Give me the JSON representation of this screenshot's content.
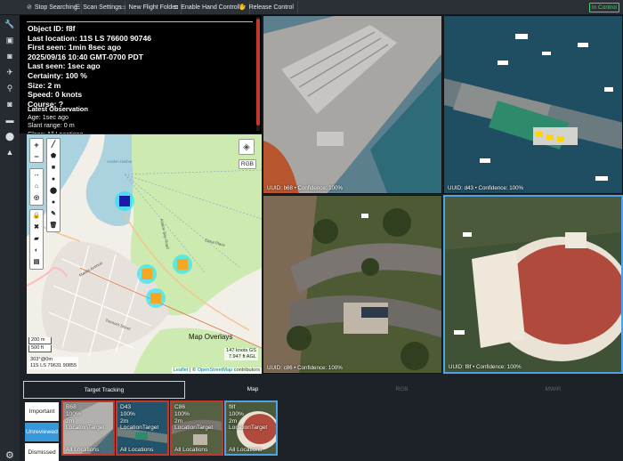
{
  "toolbar": {
    "buttons": [
      {
        "label": "Stop Searching",
        "icon": "no-entry-icon"
      },
      {
        "label": "Scan Settings",
        "icon": "sliders-icon"
      },
      {
        "label": "New Flight Folder",
        "icon": "folder-icon"
      },
      {
        "label": "Enable Hand Controller",
        "icon": "gamepad-icon"
      },
      {
        "label": "Release Control",
        "icon": "hand-icon"
      }
    ],
    "status": "In Control",
    "status_color": "#45d16b"
  },
  "rail": {
    "icons": [
      "wrench-icon",
      "image-icon",
      "camera-icon",
      "plane-icon",
      "person-icon",
      "camera-alt-icon",
      "truck-icon",
      "map-pin-icon",
      "graduation-cap-icon"
    ],
    "settings_icon": "gear-icon"
  },
  "info": {
    "object_id": "Object ID: f8f",
    "last_location": "Last location: 11S LS 76600 90746",
    "first_seen": "First seen: 1min 8sec ago",
    "first_seen_time": "2025/09/16 10:40 GMT-0700 PDT",
    "last_seen": "Last seen: 1sec ago",
    "certainty": "Certainty: 100 %",
    "size": "Size: 2 m",
    "speed": "Speed: 0 knots",
    "course": "Course: ?",
    "latest_title": "Latest Observation",
    "latest_age": "Age: 1sec ago",
    "latest_range": "Slant range: 0 m",
    "latest_class": "Class: All Locations"
  },
  "map": {
    "rgb_label": "RGB",
    "overlays_label": "Map Overlays",
    "scale_m": "200 m",
    "scale_ft": "500 ft",
    "heading": "303°@0m",
    "coords": "11S LS 79631 90855",
    "gsd_line1": "147 knots GS",
    "gsd_line2": "7.947 ft AGL",
    "attrib_leaflet": "Leaflet",
    "attrib_osm": "OpenStreetMap",
    "attrib_rest": "contributors",
    "street_labels": [
      "Avalon Harbor",
      "Avalon Bay Road",
      "Marilla Avenue",
      "Dana Place",
      "Tremont Street"
    ]
  },
  "tiles": [
    {
      "caption": "UUID: b68 • Confidence: 100%"
    },
    {
      "caption": "UUID: d43 • Confidence: 100%"
    },
    {
      "caption": "UUID: c86 • Confidence: 100%"
    },
    {
      "caption": "UUID: f8f • Confidence: 100%"
    }
  ],
  "tabs": [
    "Target Tracking",
    "Map",
    "RGB",
    "MWIR"
  ],
  "filters": [
    "Important",
    "Unreviewed",
    "Dismissed"
  ],
  "thumbs": [
    {
      "id": "B68",
      "certainty": "100%",
      "size": "2m",
      "type": "LocationTarget",
      "class": "All Locations"
    },
    {
      "id": "D43",
      "certainty": "100%",
      "size": "2m",
      "type": "LocationTarget",
      "class": "All Locations"
    },
    {
      "id": "C86",
      "certainty": "100%",
      "size": "2m",
      "type": "LocationTarget",
      "class": "All Locations"
    },
    {
      "id": "f8f",
      "certainty": "100%",
      "size": "2m",
      "type": "LocationTarget",
      "class": "All Locations"
    }
  ]
}
